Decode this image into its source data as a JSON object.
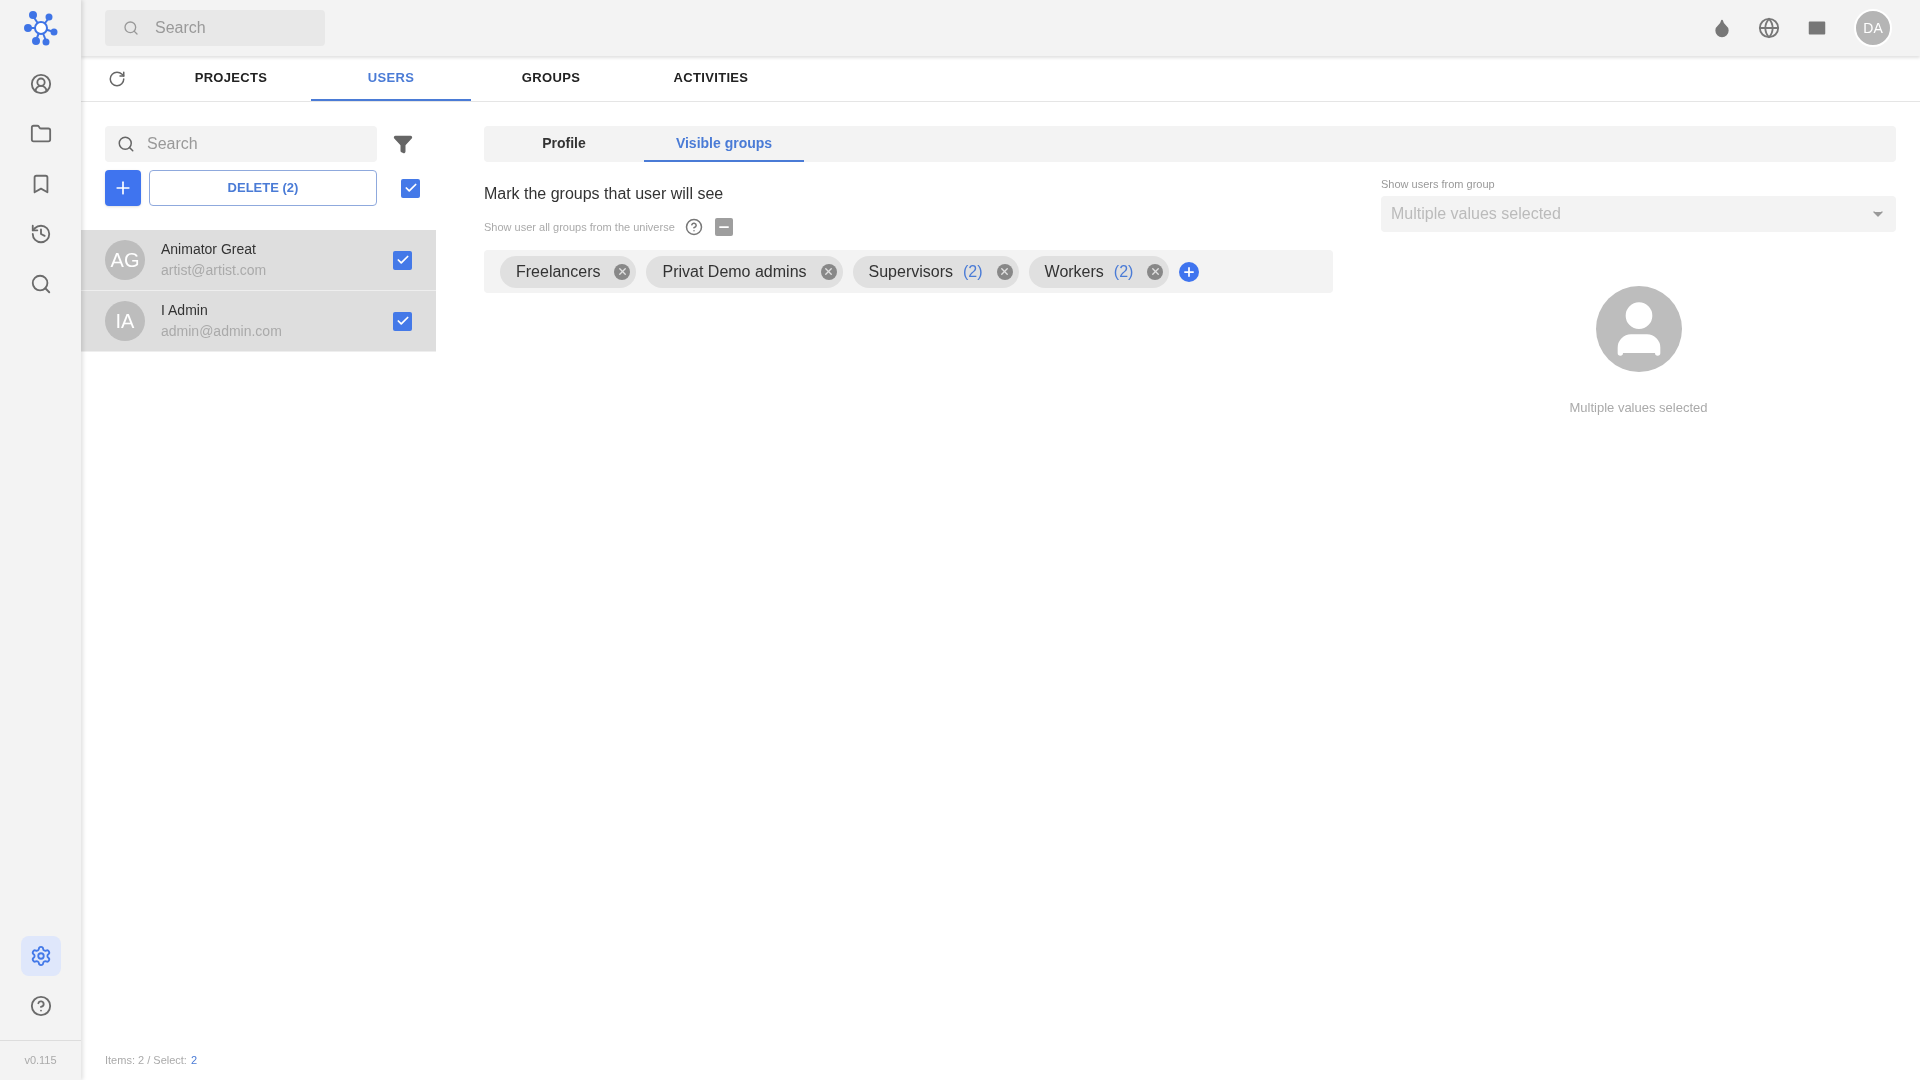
{
  "topbar": {
    "search": {
      "placeholder": "Search"
    },
    "avatar": "DA"
  },
  "sidebar": {
    "top_items": [
      {
        "selected": false
      },
      {
        "selected": false
      },
      {
        "selected": false
      },
      {
        "selected": false
      },
      {
        "selected": false
      }
    ],
    "bottom_items": [
      {
        "selected": true
      },
      {
        "selected": false
      }
    ],
    "version": "v0.115"
  },
  "tabs": [
    {
      "label": "PROJECTS",
      "selected": false
    },
    {
      "label": "USERS",
      "selected": true
    },
    {
      "label": "GROUPS",
      "selected": false
    },
    {
      "label": "ACTIVITIES",
      "selected": false
    }
  ],
  "user_list": {
    "search": {
      "placeholder": "Search"
    },
    "delete_button": "DELETE (2)",
    "select_all": {
      "checked": true
    },
    "users": [
      {
        "initials": "AG",
        "name": "Animator Great",
        "email": "artist@artist.com",
        "selected": true,
        "checked": true
      },
      {
        "initials": "IA",
        "name": "I Admin",
        "email": "admin@admin.com",
        "selected": true,
        "checked": true
      }
    ],
    "status": {
      "items_text": "Items: 2 / Select:",
      "selected_count": "2"
    }
  },
  "detail_tabs": [
    {
      "label": "Profile",
      "selected": false
    },
    {
      "label": "Visible groups",
      "selected": true
    }
  ],
  "visible_groups": {
    "heading": "Mark the groups that user will see",
    "show_all": {
      "label": "Show user all groups from the universe",
      "indeterminate": true
    },
    "groups": [
      {
        "name": "Freelancers"
      },
      {
        "name": "Privat Demo admins"
      },
      {
        "name": "Supervisors",
        "count": "(2)"
      },
      {
        "name": "Workers",
        "count": "(2)"
      }
    ]
  },
  "group_filter": {
    "label": "Show users from group",
    "value": "Multiple values selected",
    "caption": "Multiple values selected"
  }
}
